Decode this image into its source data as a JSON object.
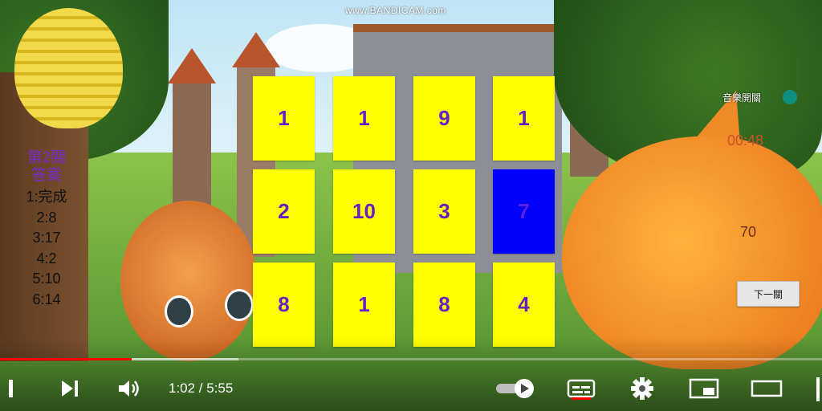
{
  "watermark": "www.BANDICAM.com",
  "left_panel": {
    "level_title_1": "第2關",
    "level_title_2": "答案",
    "answers": [
      "1:完成",
      "2:8",
      "3:17",
      "4:2",
      "5:10",
      "6:14"
    ]
  },
  "grid": {
    "cards": [
      {
        "value": "1",
        "color": "#ffff00"
      },
      {
        "value": "1",
        "color": "#ffff00"
      },
      {
        "value": "9",
        "color": "#ffff00"
      },
      {
        "value": "1",
        "color": "#ffff00"
      },
      {
        "value": "2",
        "color": "#ffff00"
      },
      {
        "value": "10",
        "color": "#ffff00"
      },
      {
        "value": "3",
        "color": "#ffff00"
      },
      {
        "value": "7",
        "color": "#0000ff"
      },
      {
        "value": "8",
        "color": "#ffff00"
      },
      {
        "value": "1",
        "color": "#ffff00"
      },
      {
        "value": "8",
        "color": "#ffff00"
      },
      {
        "value": "4",
        "color": "#ffff00"
      }
    ]
  },
  "right_panel": {
    "sound_label": "音樂開關",
    "timer": "00:48",
    "score": "70",
    "next_button": "下一關"
  },
  "player": {
    "current_time": "1:02",
    "duration": "5:55",
    "time_text": "1:02 / 5:55",
    "played_fraction": 0.16,
    "buffered_fraction": 0.29,
    "accent_color": "#ff0000"
  },
  "icons": {
    "play_pause": "pause-icon",
    "next": "next-icon",
    "volume": "volume-icon",
    "autoplay": "autoplay-toggle-icon",
    "subtitles": "subtitles-icon",
    "settings": "gear-icon",
    "miniplayer": "miniplayer-icon",
    "theater": "theater-icon"
  }
}
